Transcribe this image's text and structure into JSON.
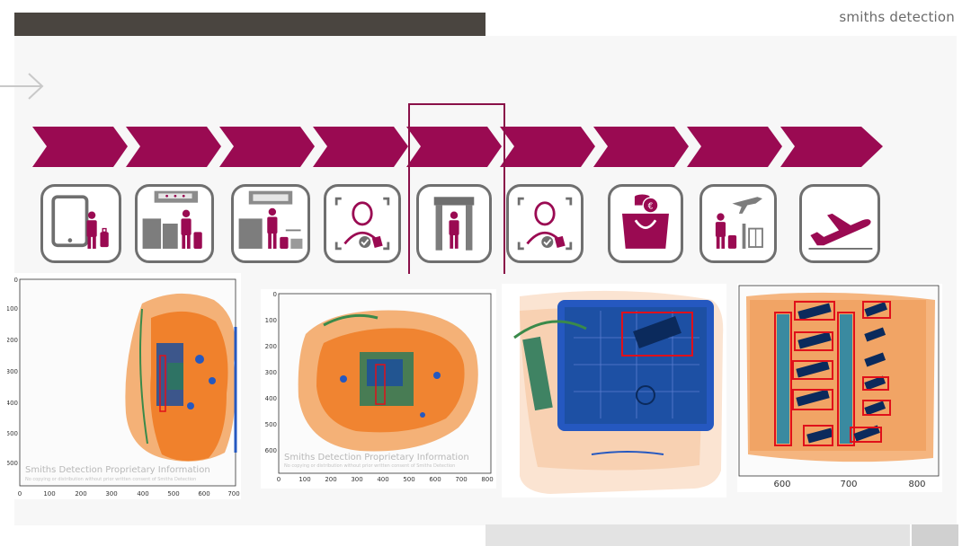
{
  "header": {
    "brand": "smiths detection"
  },
  "process": {
    "step_count": 9,
    "highlight_step": 5,
    "accent_color": "#9a0a52",
    "icons": [
      "tablet-traveler-icon",
      "check-in-counter-icon",
      "bag-drop-icon",
      "face-id-icon",
      "metal-detector-icon",
      "face-id-icon",
      "shopping-bag-icon",
      "boarding-gate-icon",
      "airplane-takeoff-icon"
    ]
  },
  "scans": {
    "scan1": {
      "y_ticks": [
        "0",
        "100",
        "200",
        "300",
        "400",
        "500",
        "600"
      ],
      "x_ticks": [
        "0",
        "100",
        "200",
        "300",
        "400",
        "500",
        "600",
        "700"
      ],
      "watermark": "Smiths Detection Proprietary Information",
      "watermark_sub": "No copying or distribution without prior written consent of Smiths Detection"
    },
    "scan2": {
      "y_ticks": [
        "0",
        "100",
        "200",
        "300",
        "400",
        "500",
        "600"
      ],
      "x_ticks": [
        "0",
        "100",
        "200",
        "300",
        "400",
        "500",
        "600",
        "700",
        "800"
      ],
      "watermark": "Smiths Detection Proprietary Information",
      "watermark_sub": "No copying or distribution without prior written consent of Smiths Detection"
    },
    "scan4": {
      "x_ticks": [
        "600",
        "700",
        "800"
      ]
    }
  },
  "colors": {
    "title_bar": "#4a4540",
    "accent": "#9a0a52",
    "icon_border": "#6f6f6f",
    "xray_orange": "#f08a3c",
    "xray_blue": "#2558c0",
    "detection_box": "#e0101a"
  }
}
